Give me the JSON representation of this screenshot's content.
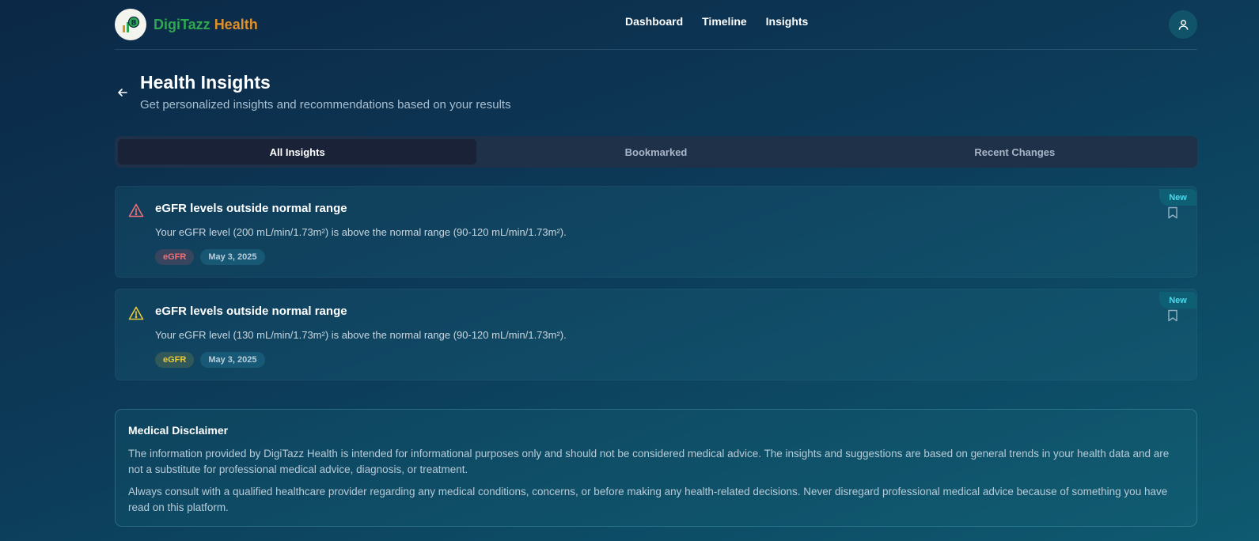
{
  "brand": {
    "name_part1": "DigiTazz",
    "name_part2": "Health",
    "logo_icon": "chart-logo-icon"
  },
  "nav": {
    "items": [
      "Dashboard",
      "Timeline",
      "Insights"
    ]
  },
  "user": {
    "icon": "user-icon"
  },
  "page": {
    "title": "Health Insights",
    "subtitle": "Get personalized insights and recommendations based on your results"
  },
  "tabs": [
    {
      "label": "All Insights",
      "active": true
    },
    {
      "label": "Bookmarked",
      "active": false
    },
    {
      "label": "Recent Changes",
      "active": false
    }
  ],
  "insights": [
    {
      "severity": "high",
      "severity_color": "#f06f78",
      "title": "eGFR levels outside normal range",
      "text": "Your eGFR level (200 mL/min/1.73m²) is above the normal range (90-120 mL/min/1.73m²).",
      "tag": "eGFR",
      "date": "May 3, 2025",
      "badge": "New"
    },
    {
      "severity": "medium",
      "severity_color": "#e9c93a",
      "title": "eGFR levels outside normal range",
      "text": "Your eGFR level (130 mL/min/1.73m²) is above the normal range (90-120 mL/min/1.73m²).",
      "tag": "eGFR",
      "date": "May 3, 2025",
      "badge": "New"
    }
  ],
  "disclaimer": {
    "title": "Medical Disclaimer",
    "p1": "The information provided by DigiTazz Health is intended for informational purposes only and should not be considered medical advice. The insights and suggestions are based on general trends in your health data and are not a substitute for professional medical advice, diagnosis, or treatment.",
    "p2": "Always consult with a qualified healthcare provider regarding any medical conditions, concerns, or before making any health-related decisions. Never disregard professional medical advice because of something you have read on this platform."
  },
  "colors": {
    "accent": "#4fd8ec",
    "brand_green": "#2fa84f",
    "brand_orange": "#e0902a"
  }
}
